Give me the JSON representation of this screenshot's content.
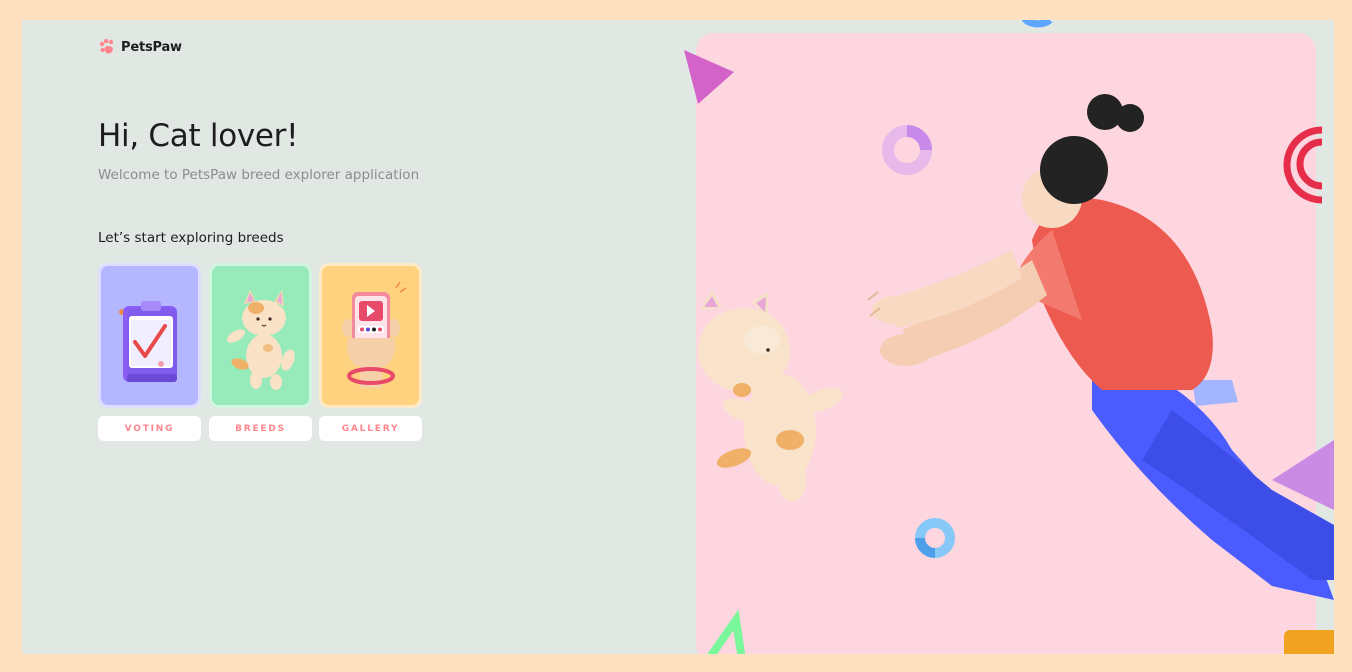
{
  "app": {
    "name": "PetsPaw",
    "logo_icon": "paw-icon"
  },
  "home": {
    "greeting": "Hi, Cat lover!",
    "subtitle": "Welcome to PetsPaw breed explorer application",
    "section_title": "Let’s start exploring breeds"
  },
  "nav": [
    {
      "label": "VOTING",
      "icon": "clipboard-check-icon"
    },
    {
      "label": "BREEDS",
      "icon": "cat-icon"
    },
    {
      "label": "GALLERY",
      "icon": "phone-gallery-icon"
    }
  ],
  "colors": {
    "background_frame": "#FFE0C0",
    "app_background": "#E1E8E4",
    "hero_background": "#FDD6DF",
    "voting_card": "#B4B7FF",
    "breeds_card": "#97EAB9",
    "gallery_card": "#FFD280",
    "accent": "#FF868E"
  }
}
